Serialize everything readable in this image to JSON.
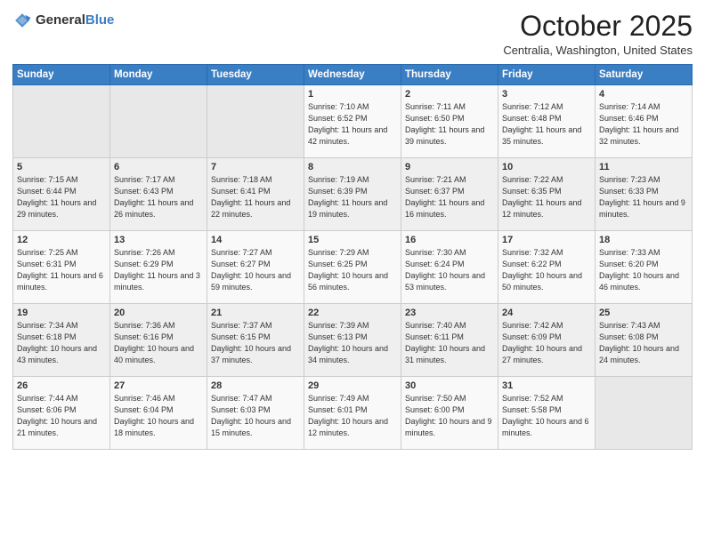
{
  "header": {
    "logo_general": "General",
    "logo_blue": "Blue",
    "month_title": "October 2025",
    "location": "Centralia, Washington, United States"
  },
  "days_of_week": [
    "Sunday",
    "Monday",
    "Tuesday",
    "Wednesday",
    "Thursday",
    "Friday",
    "Saturday"
  ],
  "weeks": [
    [
      {
        "day": "",
        "info": ""
      },
      {
        "day": "",
        "info": ""
      },
      {
        "day": "",
        "info": ""
      },
      {
        "day": "1",
        "info": "Sunrise: 7:10 AM\nSunset: 6:52 PM\nDaylight: 11 hours\nand 42 minutes."
      },
      {
        "day": "2",
        "info": "Sunrise: 7:11 AM\nSunset: 6:50 PM\nDaylight: 11 hours\nand 39 minutes."
      },
      {
        "day": "3",
        "info": "Sunrise: 7:12 AM\nSunset: 6:48 PM\nDaylight: 11 hours\nand 35 minutes."
      },
      {
        "day": "4",
        "info": "Sunrise: 7:14 AM\nSunset: 6:46 PM\nDaylight: 11 hours\nand 32 minutes."
      }
    ],
    [
      {
        "day": "5",
        "info": "Sunrise: 7:15 AM\nSunset: 6:44 PM\nDaylight: 11 hours\nand 29 minutes."
      },
      {
        "day": "6",
        "info": "Sunrise: 7:17 AM\nSunset: 6:43 PM\nDaylight: 11 hours\nand 26 minutes."
      },
      {
        "day": "7",
        "info": "Sunrise: 7:18 AM\nSunset: 6:41 PM\nDaylight: 11 hours\nand 22 minutes."
      },
      {
        "day": "8",
        "info": "Sunrise: 7:19 AM\nSunset: 6:39 PM\nDaylight: 11 hours\nand 19 minutes."
      },
      {
        "day": "9",
        "info": "Sunrise: 7:21 AM\nSunset: 6:37 PM\nDaylight: 11 hours\nand 16 minutes."
      },
      {
        "day": "10",
        "info": "Sunrise: 7:22 AM\nSunset: 6:35 PM\nDaylight: 11 hours\nand 12 minutes."
      },
      {
        "day": "11",
        "info": "Sunrise: 7:23 AM\nSunset: 6:33 PM\nDaylight: 11 hours\nand 9 minutes."
      }
    ],
    [
      {
        "day": "12",
        "info": "Sunrise: 7:25 AM\nSunset: 6:31 PM\nDaylight: 11 hours\nand 6 minutes."
      },
      {
        "day": "13",
        "info": "Sunrise: 7:26 AM\nSunset: 6:29 PM\nDaylight: 11 hours\nand 3 minutes."
      },
      {
        "day": "14",
        "info": "Sunrise: 7:27 AM\nSunset: 6:27 PM\nDaylight: 10 hours\nand 59 minutes."
      },
      {
        "day": "15",
        "info": "Sunrise: 7:29 AM\nSunset: 6:25 PM\nDaylight: 10 hours\nand 56 minutes."
      },
      {
        "day": "16",
        "info": "Sunrise: 7:30 AM\nSunset: 6:24 PM\nDaylight: 10 hours\nand 53 minutes."
      },
      {
        "day": "17",
        "info": "Sunrise: 7:32 AM\nSunset: 6:22 PM\nDaylight: 10 hours\nand 50 minutes."
      },
      {
        "day": "18",
        "info": "Sunrise: 7:33 AM\nSunset: 6:20 PM\nDaylight: 10 hours\nand 46 minutes."
      }
    ],
    [
      {
        "day": "19",
        "info": "Sunrise: 7:34 AM\nSunset: 6:18 PM\nDaylight: 10 hours\nand 43 minutes."
      },
      {
        "day": "20",
        "info": "Sunrise: 7:36 AM\nSunset: 6:16 PM\nDaylight: 10 hours\nand 40 minutes."
      },
      {
        "day": "21",
        "info": "Sunrise: 7:37 AM\nSunset: 6:15 PM\nDaylight: 10 hours\nand 37 minutes."
      },
      {
        "day": "22",
        "info": "Sunrise: 7:39 AM\nSunset: 6:13 PM\nDaylight: 10 hours\nand 34 minutes."
      },
      {
        "day": "23",
        "info": "Sunrise: 7:40 AM\nSunset: 6:11 PM\nDaylight: 10 hours\nand 31 minutes."
      },
      {
        "day": "24",
        "info": "Sunrise: 7:42 AM\nSunset: 6:09 PM\nDaylight: 10 hours\nand 27 minutes."
      },
      {
        "day": "25",
        "info": "Sunrise: 7:43 AM\nSunset: 6:08 PM\nDaylight: 10 hours\nand 24 minutes."
      }
    ],
    [
      {
        "day": "26",
        "info": "Sunrise: 7:44 AM\nSunset: 6:06 PM\nDaylight: 10 hours\nand 21 minutes."
      },
      {
        "day": "27",
        "info": "Sunrise: 7:46 AM\nSunset: 6:04 PM\nDaylight: 10 hours\nand 18 minutes."
      },
      {
        "day": "28",
        "info": "Sunrise: 7:47 AM\nSunset: 6:03 PM\nDaylight: 10 hours\nand 15 minutes."
      },
      {
        "day": "29",
        "info": "Sunrise: 7:49 AM\nSunset: 6:01 PM\nDaylight: 10 hours\nand 12 minutes."
      },
      {
        "day": "30",
        "info": "Sunrise: 7:50 AM\nSunset: 6:00 PM\nDaylight: 10 hours\nand 9 minutes."
      },
      {
        "day": "31",
        "info": "Sunrise: 7:52 AM\nSunset: 5:58 PM\nDaylight: 10 hours\nand 6 minutes."
      },
      {
        "day": "",
        "info": ""
      }
    ]
  ]
}
